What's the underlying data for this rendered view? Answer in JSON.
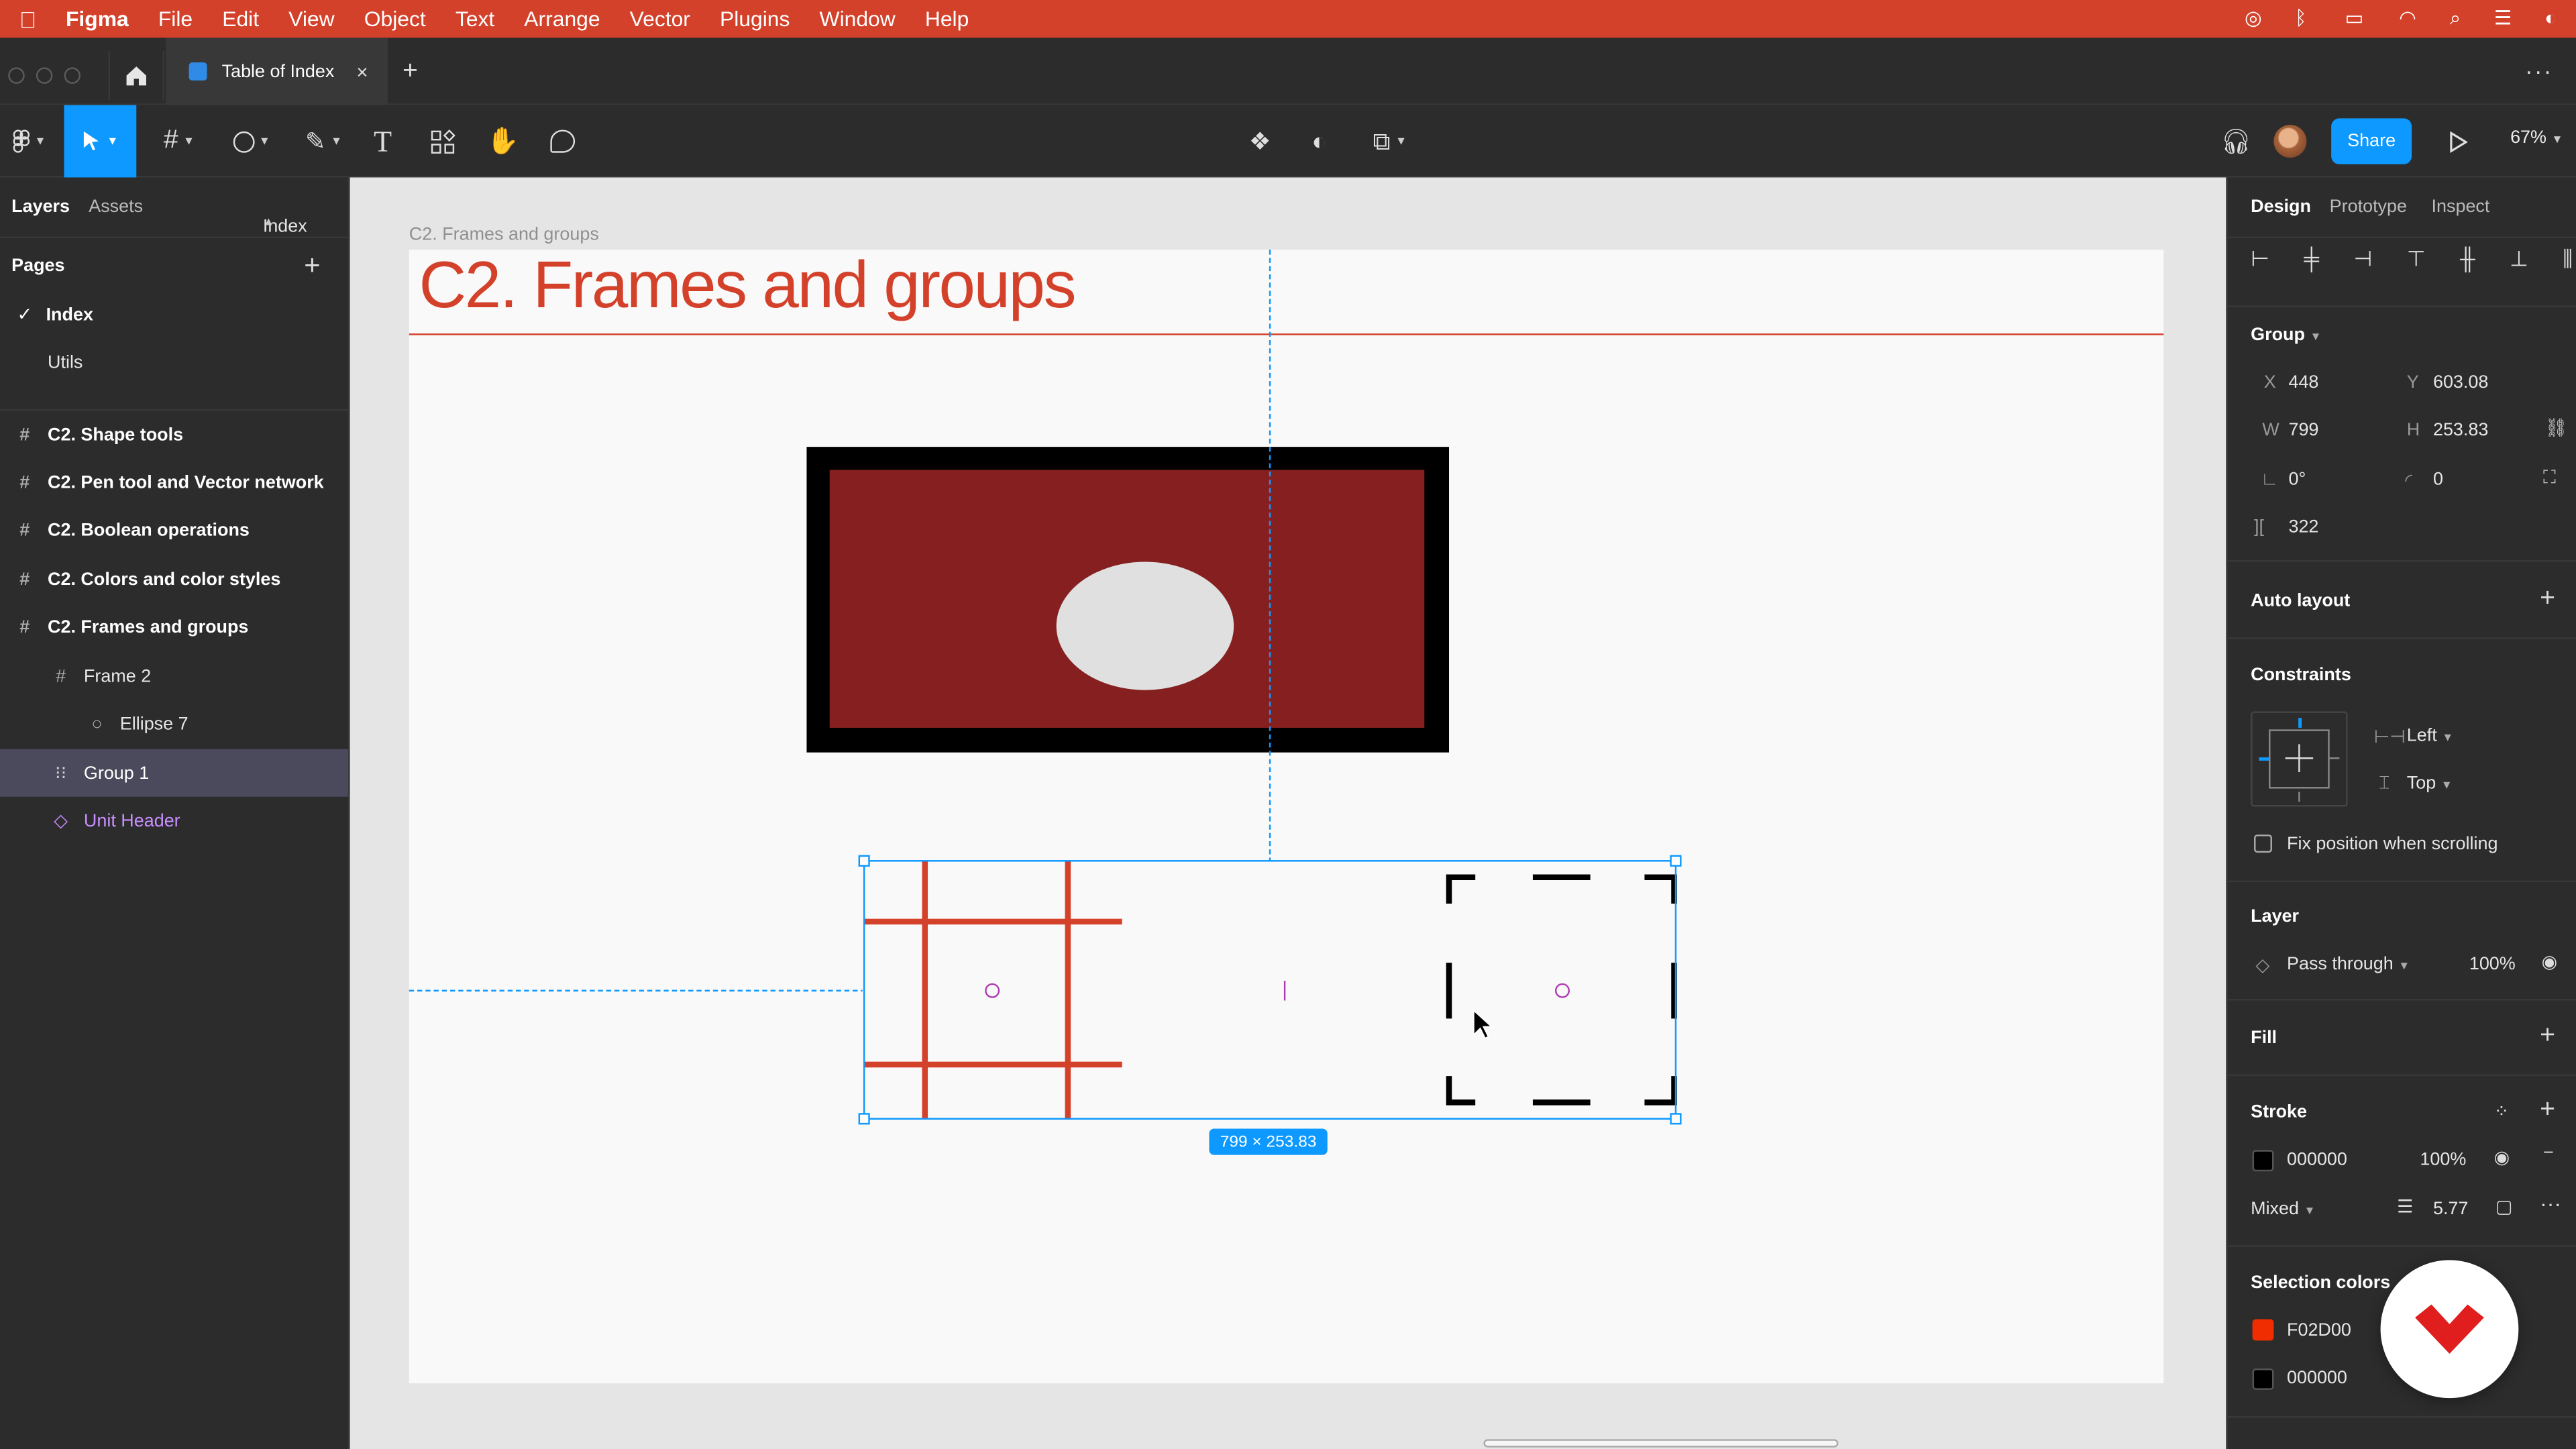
{
  "menubar": {
    "app": "Figma",
    "items": [
      "File",
      "Edit",
      "View",
      "Object",
      "Text",
      "Arrange",
      "Vector",
      "Plugins",
      "Window",
      "Help"
    ]
  },
  "tabs": {
    "file_title": "Table of Index",
    "close": "×",
    "new": "+",
    "more": "···"
  },
  "toolbar": {
    "share_label": "Share",
    "zoom": "67%",
    "selected_tool": "move-tool"
  },
  "left_panel": {
    "tabs": {
      "layers": "Layers",
      "assets": "Assets",
      "page_switcher": "Index"
    },
    "pages_header": "Pages",
    "pages": [
      {
        "label": "Index",
        "checked": true
      },
      {
        "label": "Utils",
        "checked": false
      }
    ],
    "layers": [
      {
        "label": "C2. Shape tools",
        "icon": "frame-icon",
        "indent": 0
      },
      {
        "label": "C2. Pen tool and Vector network",
        "icon": "frame-icon",
        "indent": 0
      },
      {
        "label": "C2. Boolean operations",
        "icon": "frame-icon",
        "indent": 0
      },
      {
        "label": "C2. Colors and color styles",
        "icon": "frame-icon",
        "indent": 0
      },
      {
        "label": "C2. Frames and groups",
        "icon": "frame-icon",
        "indent": 0
      },
      {
        "label": "Frame 2",
        "icon": "frame-icon",
        "indent": 1
      },
      {
        "label": "Ellipse 7",
        "icon": "ellipse-icon",
        "indent": 2
      },
      {
        "label": "Group 1",
        "icon": "group-icon",
        "indent": 1,
        "selected": true
      },
      {
        "label": "Unit Header",
        "icon": "component-icon",
        "indent": 1,
        "component": true
      }
    ]
  },
  "canvas": {
    "frame_label": "C2. Frames and groups",
    "frame_title": "C2.  Frames and groups",
    "selection_size": "799 × 253.83",
    "accent_color": "#D4412B",
    "selection_color": "#0D99FF"
  },
  "right_panel": {
    "tabs": {
      "design": "Design",
      "prototype": "Prototype",
      "inspect": "Inspect"
    },
    "group_label": "Group",
    "x_label": "X",
    "x": "448",
    "y_label": "Y",
    "y": "603.08",
    "w_label": "W",
    "w": "799",
    "h_label": "H",
    "h": "253.83",
    "rotation": "0°",
    "radius": "0",
    "spacing": "322",
    "auto_layout": "Auto layout",
    "constraints": "Constraints",
    "constraint_h": "Left",
    "constraint_v": "Top",
    "fix_position": "Fix position when scrolling",
    "layer": "Layer",
    "blend": "Pass through",
    "opacity": "100%",
    "fill": "Fill",
    "stroke": "Stroke",
    "stroke_color": "000000",
    "stroke_opacity": "100%",
    "stroke_type": "Mixed",
    "stroke_weight": "5.77",
    "selection_colors": "Selection colors",
    "sel_colors": [
      {
        "hex": "F02D00",
        "color": "#F02D00"
      },
      {
        "hex": "000000",
        "color": "#000000"
      }
    ]
  }
}
